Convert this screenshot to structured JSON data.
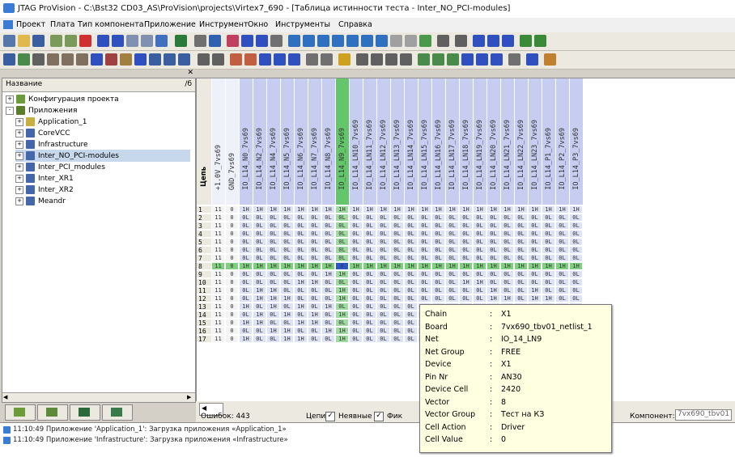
{
  "window": {
    "title": "JTAG ProVision - C:\\Bst32 CD03_AS\\ProVision\\projects\\Virtex7_690 - [Таблица истинности теста - Inter_NO_PCI-modules]"
  },
  "menu": {
    "items": [
      "Проект",
      "Плата",
      "Тип компонента",
      "Приложение",
      "Инструмент",
      "Окно",
      "Инструменты",
      "Справка"
    ]
  },
  "colors": {
    "header_blue": "#c6cdf0",
    "selected_green": "#63c66b",
    "tooltip_bg": "#ffffe1"
  },
  "tree": {
    "header_label": "Название",
    "header_right": "/б",
    "items": [
      {
        "label": "Конфигурация проекта",
        "indent": 0,
        "expander": "+",
        "icon": "config-icon",
        "color": "#6a9d3a"
      },
      {
        "label": "Приложения",
        "indent": 0,
        "expander": "-",
        "icon": "apps-folder-icon",
        "color": "#5a7d2a"
      },
      {
        "label": "Application_1",
        "indent": 1,
        "expander": "+",
        "icon": "app-icon",
        "color": "#c8b040"
      },
      {
        "label": "CoreVCC",
        "indent": 1,
        "expander": "+",
        "icon": "app-icon",
        "color": "#4466aa"
      },
      {
        "label": "Infrastructure",
        "indent": 1,
        "expander": "+",
        "icon": "app-icon",
        "color": "#4466aa"
      },
      {
        "label": "Inter_NO_PCI-modules",
        "indent": 1,
        "expander": "+",
        "icon": "app-icon",
        "color": "#4466aa",
        "selected": true
      },
      {
        "label": "Inter_PCI_modules",
        "indent": 1,
        "expander": "+",
        "icon": "app-icon",
        "color": "#4466aa"
      },
      {
        "label": "Inter_XR1",
        "indent": 1,
        "expander": "+",
        "icon": "app-icon",
        "color": "#4466aa"
      },
      {
        "label": "Inter_XR2",
        "indent": 1,
        "expander": "+",
        "icon": "app-icon",
        "color": "#4466aa"
      },
      {
        "label": "Meandr",
        "indent": 1,
        "expander": "+",
        "icon": "app-icon",
        "color": "#4466aa"
      }
    ]
  },
  "grid": {
    "corner_label": "Цепь",
    "columns": [
      {
        "label": "+1.0V_7vs69",
        "style": "white"
      },
      {
        "label": "GND_7vs69",
        "style": "white"
      },
      {
        "label": "IO_L14_N0_7vs69",
        "style": "blue"
      },
      {
        "label": "IO_L14_N2_7vs69",
        "style": "blue"
      },
      {
        "label": "IO_L14_N4_7vs69",
        "style": "blue"
      },
      {
        "label": "IO_L14_N5_7vs69",
        "style": "blue"
      },
      {
        "label": "IO_L14_N6_7vs69",
        "style": "blue"
      },
      {
        "label": "IO_L14_N7_7vs69",
        "style": "blue"
      },
      {
        "label": "IO_L14_N8_7vs69",
        "style": "blue"
      },
      {
        "label": "IO_L14_N9_7vs69",
        "style": "green"
      },
      {
        "label": "IO_L14_LN10_7vs69",
        "style": "blue"
      },
      {
        "label": "IO_L14_LN11_7vs69",
        "style": "blue"
      },
      {
        "label": "IO_L14_LN12_7vs69",
        "style": "blue"
      },
      {
        "label": "IO_L14_LN13_7vs69",
        "style": "blue"
      },
      {
        "label": "IO_L14_LN14_7vs69",
        "style": "blue"
      },
      {
        "label": "IO_L14_LN15_7vs69",
        "style": "blue"
      },
      {
        "label": "IO_L14_LN16_7vs69",
        "style": "blue"
      },
      {
        "label": "IO_L14_LN17_7vs69",
        "style": "blue"
      },
      {
        "label": "IO_L14_LN18_7vs69",
        "style": "blue"
      },
      {
        "label": "IO_L14_LN19_7vs69",
        "style": "blue"
      },
      {
        "label": "IO_L14_LN20_7vs69",
        "style": "blue"
      },
      {
        "label": "IO_L14_LN21_7vs69",
        "style": "blue"
      },
      {
        "label": "IO_L14_LN22_7vs69",
        "style": "blue"
      },
      {
        "label": "IO_L14_LN23_7vs69",
        "style": "blue"
      },
      {
        "label": "IO_L14_P1_7vs69",
        "style": "blue"
      },
      {
        "label": "IO_L14_P2_7vs69",
        "style": "blue"
      },
      {
        "label": "IO_L14_P3_7vs69",
        "style": "blue"
      }
    ],
    "rows": [
      {
        "n": "1",
        "cells": [
          "11",
          "0",
          "1H",
          "1H",
          "1H",
          "1H",
          "1H",
          "1H",
          "1H",
          "1H",
          "1H",
          "1H",
          "1H",
          "1H",
          "1H",
          "1H",
          "1H",
          "1H",
          "1H",
          "1H",
          "1H",
          "1H",
          "1H",
          "1H",
          "1H",
          "1H",
          "1H"
        ]
      },
      {
        "n": "2",
        "cells": [
          "11",
          "0",
          "0L",
          "0L",
          "0L",
          "0L",
          "0L",
          "0L",
          "0L",
          "0L",
          "0L",
          "0L",
          "0L",
          "0L",
          "0L",
          "0L",
          "0L",
          "0L",
          "0L",
          "0L",
          "0L",
          "0L",
          "0L",
          "0L",
          "0L",
          "0L",
          "0L"
        ]
      },
      {
        "n": "3",
        "cells": [
          "11",
          "0",
          "0L",
          "0L",
          "0L",
          "0L",
          "0L",
          "0L",
          "0L",
          "0L",
          "0L",
          "0L",
          "0L",
          "0L",
          "0L",
          "0L",
          "0L",
          "0L",
          "0L",
          "0L",
          "0L",
          "0L",
          "0L",
          "0L",
          "0L",
          "0L",
          "0L"
        ]
      },
      {
        "n": "4",
        "cells": [
          "11",
          "0",
          "0L",
          "0L",
          "0L",
          "0L",
          "0L",
          "0L",
          "0L",
          "0L",
          "0L",
          "0L",
          "0L",
          "0L",
          "0L",
          "0L",
          "0L",
          "0L",
          "0L",
          "0L",
          "0L",
          "0L",
          "0L",
          "0L",
          "0L",
          "0L",
          "0L"
        ]
      },
      {
        "n": "5",
        "cells": [
          "11",
          "0",
          "0L",
          "0L",
          "0L",
          "0L",
          "0L",
          "0L",
          "0L",
          "0L",
          "0L",
          "0L",
          "0L",
          "0L",
          "0L",
          "0L",
          "0L",
          "0L",
          "0L",
          "0L",
          "0L",
          "0L",
          "0L",
          "0L",
          "0L",
          "0L",
          "0L"
        ]
      },
      {
        "n": "6",
        "cells": [
          "11",
          "0",
          "0L",
          "0L",
          "0L",
          "0L",
          "0L",
          "0L",
          "0L",
          "0L",
          "0L",
          "0L",
          "0L",
          "0L",
          "0L",
          "0L",
          "0L",
          "0L",
          "0L",
          "0L",
          "0L",
          "0L",
          "0L",
          "0L",
          "0L",
          "0L",
          "0L"
        ]
      },
      {
        "n": "7",
        "cells": [
          "11",
          "0",
          "0L",
          "0L",
          "0L",
          "0L",
          "0L",
          "0L",
          "0L",
          "0L",
          "0L",
          "0L",
          "0L",
          "0L",
          "0L",
          "0L",
          "0L",
          "0L",
          "0L",
          "0L",
          "0L",
          "0L",
          "0L",
          "0L",
          "0L",
          "0L",
          "0L"
        ]
      },
      {
        "n": "8",
        "highlight": true,
        "cells": [
          "11",
          "0",
          "1H",
          "1H",
          "1H",
          "1H",
          "1H",
          "1H",
          "1H",
          "0",
          "1H",
          "1H",
          "1H",
          "1H",
          "1H",
          "1H",
          "1H",
          "1H",
          "1H",
          "1H",
          "1H",
          "1H",
          "1H",
          "1H",
          "1H",
          "1H",
          "1H"
        ]
      },
      {
        "n": "9",
        "cells": [
          "11",
          "0",
          "0L",
          "0L",
          "0L",
          "0L",
          "0L",
          "0L",
          "1H",
          "1H",
          "0L",
          "0L",
          "0L",
          "0L",
          "0L",
          "0L",
          "0L",
          "0L",
          "0L",
          "0L",
          "0L",
          "0L",
          "0L",
          "0L",
          "0L",
          "0L",
          "0L"
        ]
      },
      {
        "n": "10",
        "cells": [
          "11",
          "0",
          "0L",
          "0L",
          "0L",
          "0L",
          "1H",
          "1H",
          "0L",
          "0L",
          "0L",
          "0L",
          "0L",
          "0L",
          "0L",
          "0L",
          "0L",
          "0L",
          "1H",
          "1H",
          "0L",
          "0L",
          "0L",
          "0L",
          "0L",
          "0L",
          "0L"
        ]
      },
      {
        "n": "11",
        "cells": [
          "11",
          "0",
          "0L",
          "1H",
          "1H",
          "0L",
          "0L",
          "0L",
          "0L",
          "1H",
          "0L",
          "0L",
          "0L",
          "0L",
          "0L",
          "0L",
          "0L",
          "0L",
          "0L",
          "0L",
          "1H",
          "0L",
          "0L",
          "1H",
          "0L",
          "0L",
          "0L"
        ]
      },
      {
        "n": "12",
        "cells": [
          "11",
          "0",
          "0L",
          "1H",
          "1H",
          "1H",
          "0L",
          "0L",
          "0L",
          "1H",
          "0L",
          "0L",
          "0L",
          "0L",
          "0L",
          "0L",
          "0L",
          "0L",
          "0L",
          "0L",
          "1H",
          "1H",
          "0L",
          "1H",
          "1H",
          "0L",
          "0L"
        ]
      },
      {
        "n": "13",
        "cells": [
          "11",
          "0",
          "1H",
          "0L",
          "1H",
          "0L",
          "1H",
          "0L",
          "1H",
          "0L",
          "0L",
          "0L",
          "0L",
          "0L",
          "0L",
          "0L",
          "0L",
          "0L",
          "0L",
          "0L",
          "0L",
          "1H",
          "0L",
          "1H",
          "0L",
          "1H",
          "0L"
        ]
      },
      {
        "n": "14",
        "cells": [
          "11",
          "0",
          "0L",
          "1H",
          "0L",
          "1H",
          "0L",
          "1H",
          "0L",
          "1H",
          "0L",
          "0L",
          "0L",
          "0L",
          "0L",
          "0L",
          "0L",
          "0L",
          "0L",
          "0L",
          "1H",
          "0L",
          "1H",
          "0L",
          "1H",
          "0L",
          "1H"
        ]
      },
      {
        "n": "15",
        "cells": [
          "11",
          "0",
          "1H",
          "1H",
          "0L",
          "0L",
          "1H",
          "1H",
          "0L",
          "0L",
          "0L",
          "0L",
          "0L",
          "0L",
          "0L",
          "0L",
          "0L",
          "0L",
          "0L",
          "0L",
          "0L",
          "1H",
          "1H",
          "0L",
          "0L",
          "1H",
          "1H"
        ]
      },
      {
        "n": "16",
        "cells": [
          "11",
          "0",
          "0L",
          "0L",
          "1H",
          "1H",
          "0L",
          "0L",
          "1H",
          "1H",
          "0L",
          "0L",
          "0L",
          "0L",
          "0L",
          "0L",
          "0L",
          "0L",
          "0L",
          "0L",
          "1H",
          "0L",
          "1H",
          "1H",
          "0L",
          "0L",
          "1H"
        ]
      },
      {
        "n": "17",
        "cells": [
          "11",
          "0",
          "1H",
          "0L",
          "0L",
          "1H",
          "1H",
          "0L",
          "0L",
          "1H",
          "0L",
          "0L",
          "0L",
          "0L",
          "0L",
          "0L",
          "0L",
          "0L",
          "0L",
          "0L",
          "0L",
          "1H",
          "0L",
          "1H",
          "1H",
          "0L",
          "0L"
        ]
      }
    ]
  },
  "tooltip": {
    "rows": [
      {
        "key": "Chain",
        "value": "X1"
      },
      {
        "key": "Board",
        "value": "7vx690_tbv01_netlist_1"
      },
      {
        "key": "Net",
        "value": "IO_14_LN9"
      },
      {
        "key": "Net Group",
        "value": "FREE"
      },
      {
        "key": "Device",
        "value": "X1"
      },
      {
        "key": "Pin Nr",
        "value": "AN30"
      },
      {
        "key": "Device Cell",
        "value": "2420"
      },
      {
        "key": "Vector",
        "value": "8"
      },
      {
        "key": "Vector Group",
        "value": "Тест на КЗ"
      },
      {
        "key": "Cell Action",
        "value": "Driver"
      },
      {
        "key": "Cell Value",
        "value": "0"
      }
    ],
    "separator": ":"
  },
  "status": {
    "errors_label": "Ошибок: 443",
    "nets_label": "Цепи",
    "unchecked_label": "Неявные",
    "fixed_label": "Фик",
    "component_label": "Компонент:",
    "component_value": "7vx690_tbv01"
  },
  "log": {
    "lines": [
      "11:10:49  Приложение 'Application_1': Загрузка приложения «Application_1»",
      "11:10:49  Приложение 'Infrastructure': Загрузка приложения «Infrastructure»"
    ]
  }
}
